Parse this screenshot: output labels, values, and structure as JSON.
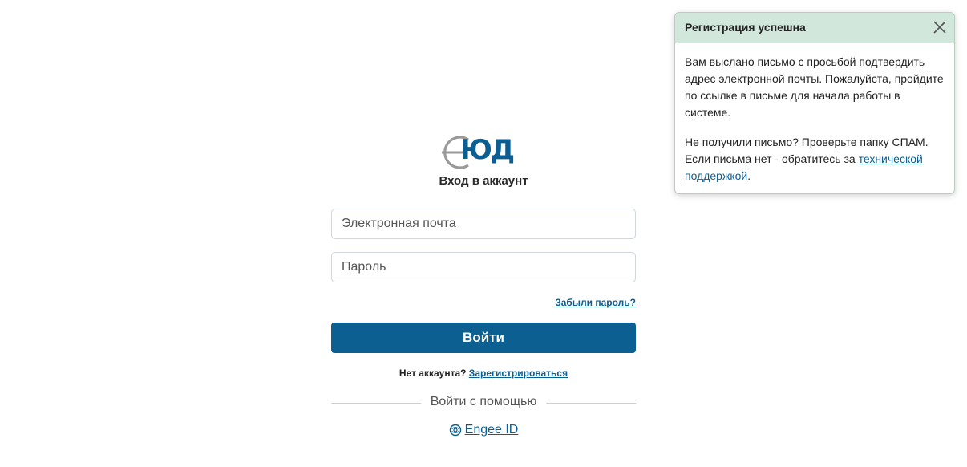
{
  "logo": {
    "text": "ЮД",
    "name": "logo"
  },
  "login": {
    "title": "Вход в аккаунт",
    "email_placeholder": "Электронная почта",
    "email_value": "",
    "password_placeholder": "Пароль",
    "password_value": "",
    "forgot_label": "Забыли пароль?",
    "submit_label": "Войти",
    "no_account_text": "Нет аккаунта?",
    "register_label": "Зарегистрироваться",
    "divider_text": "Войти с помощью",
    "engee_label": "Engee ID"
  },
  "toast": {
    "title": "Регистрация успешна",
    "paragraph1": "Вам выслано письмо с просьбой подтвердить адрес электронной почты. Пожалуйста, пройдите по ссылке в письме для начала работы в системе.",
    "paragraph2_prefix": "Не получили письмо? Проверьте папку СПАМ. Если письма нет - обратитесь за",
    "paragraph2_link": "технической поддержкой",
    "paragraph2_suffix": "."
  },
  "icons": {
    "close": "close-icon",
    "engee": "engee-icon"
  },
  "colors": {
    "primary": "#0b5f91",
    "link": "#0a5e91",
    "toast_header": "#d2e7dc",
    "border": "#cfd6dc"
  }
}
